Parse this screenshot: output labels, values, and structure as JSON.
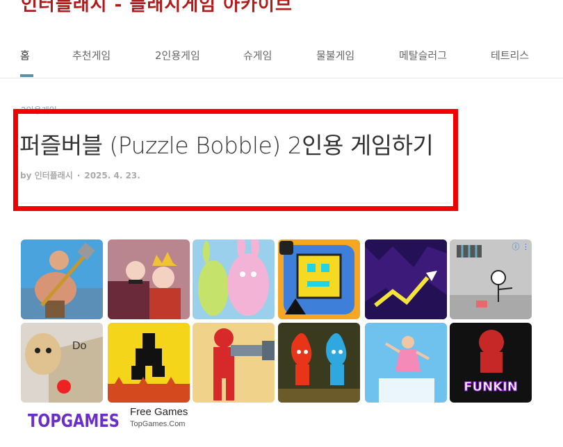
{
  "site": {
    "title": "인터플래시 - 플래시게임 아카이브"
  },
  "nav": {
    "items": [
      {
        "label": "홈"
      },
      {
        "label": "추천게임"
      },
      {
        "label": "2인용게임"
      },
      {
        "label": "슈게임"
      },
      {
        "label": "물불게임"
      },
      {
        "label": "메탈슬러그"
      },
      {
        "label": "테트리스"
      }
    ]
  },
  "post": {
    "category": "2인용게임",
    "title": "퍼즐버블 (Puzzle Bobble) 2인용 게임하기",
    "author": "by 인터플래시",
    "date": "2025. 4. 23."
  },
  "ad": {
    "advertiser": "Free Games",
    "url": "TopGames.Com",
    "logo_text": "TOPGAMES",
    "tile_label_do": "Do",
    "tile_label_fnf": "FUNKIN",
    "choices_icon": "adchoices-icon",
    "menu_icon": "more-vert-icon"
  },
  "colors": {
    "brand": "#b01c1c",
    "accent": "#5a8fa8",
    "highlight": "#f00000"
  }
}
